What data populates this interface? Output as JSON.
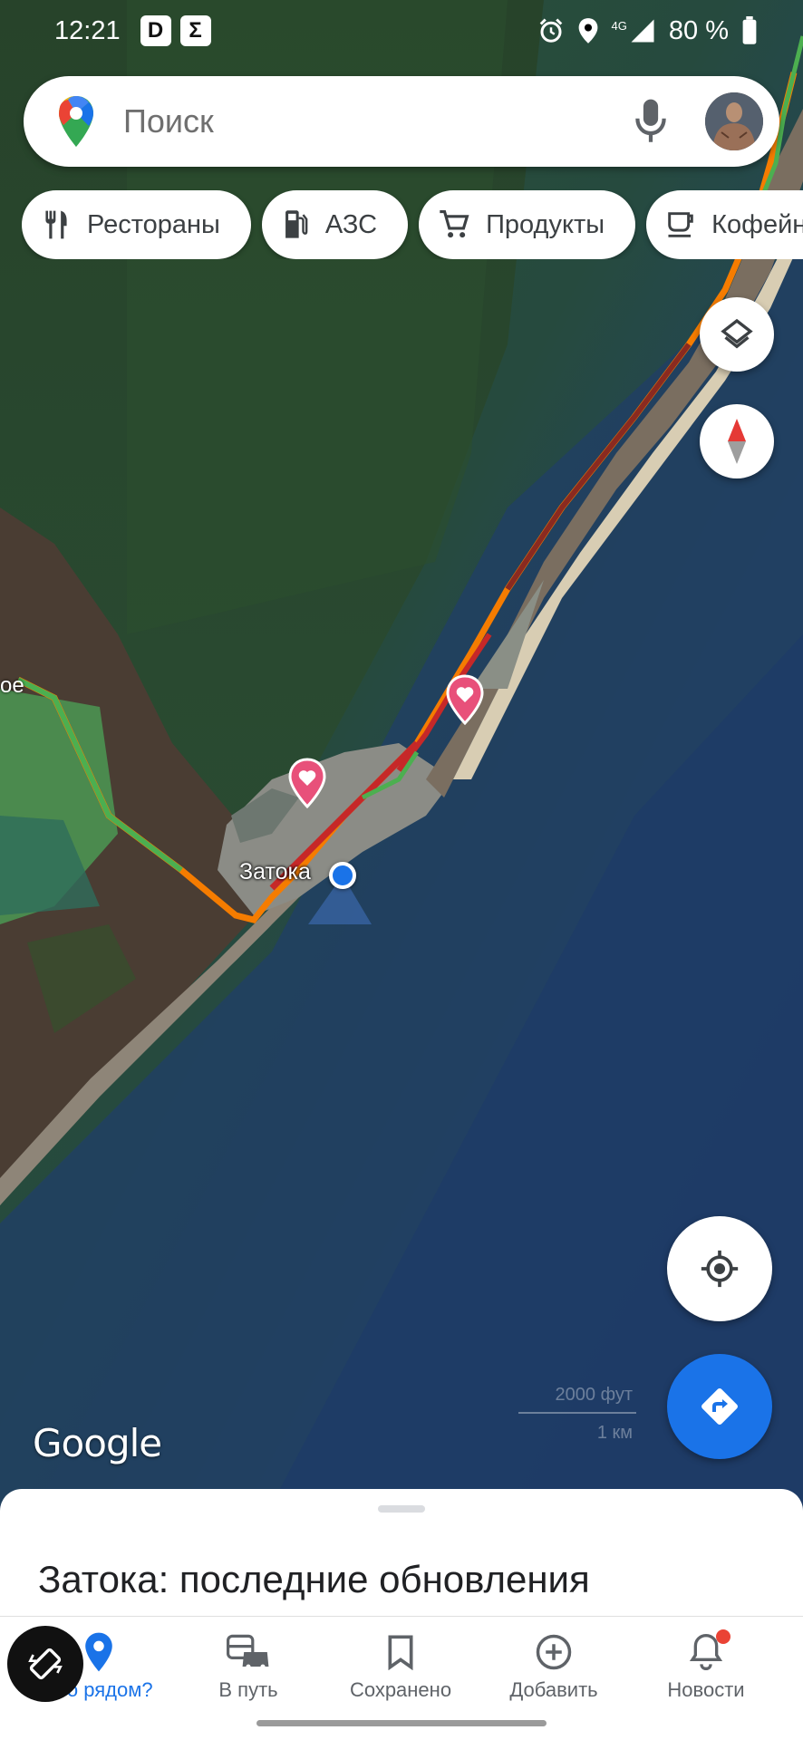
{
  "status_bar": {
    "time": "12:21",
    "app_icon_1": "D",
    "app_icon_2": "Σ",
    "network": "4G",
    "battery": "80 %"
  },
  "search": {
    "placeholder": "Поиск"
  },
  "chips": [
    {
      "label": "Рестораны",
      "icon": "restaurant-icon"
    },
    {
      "label": "АЗС",
      "icon": "gas-station-icon"
    },
    {
      "label": "Продукты",
      "icon": "cart-icon"
    },
    {
      "label": "Кофейни",
      "icon": "coffee-icon"
    }
  ],
  "map": {
    "place_label": "Затока",
    "edge_label": "ое",
    "attribution": "Google",
    "scale_ft": "2000 фут",
    "scale_km": "1 км",
    "colors": {
      "traffic_green": "#4caf50",
      "traffic_orange": "#f57c00",
      "traffic_red": "#c62828",
      "favorite_pin": "#e8507a",
      "accent": "#1a73e8"
    }
  },
  "bottom_sheet": {
    "title": "Затока: последние обновления"
  },
  "nav": [
    {
      "label": "Что рядом?",
      "icon": "location-pin-icon",
      "active": true
    },
    {
      "label": "В путь",
      "icon": "commute-icon",
      "active": false
    },
    {
      "label": "Сохранено",
      "icon": "bookmark-icon",
      "active": false
    },
    {
      "label": "Добавить",
      "icon": "add-circle-icon",
      "active": false
    },
    {
      "label": "Новости",
      "icon": "bell-icon",
      "active": false
    }
  ]
}
